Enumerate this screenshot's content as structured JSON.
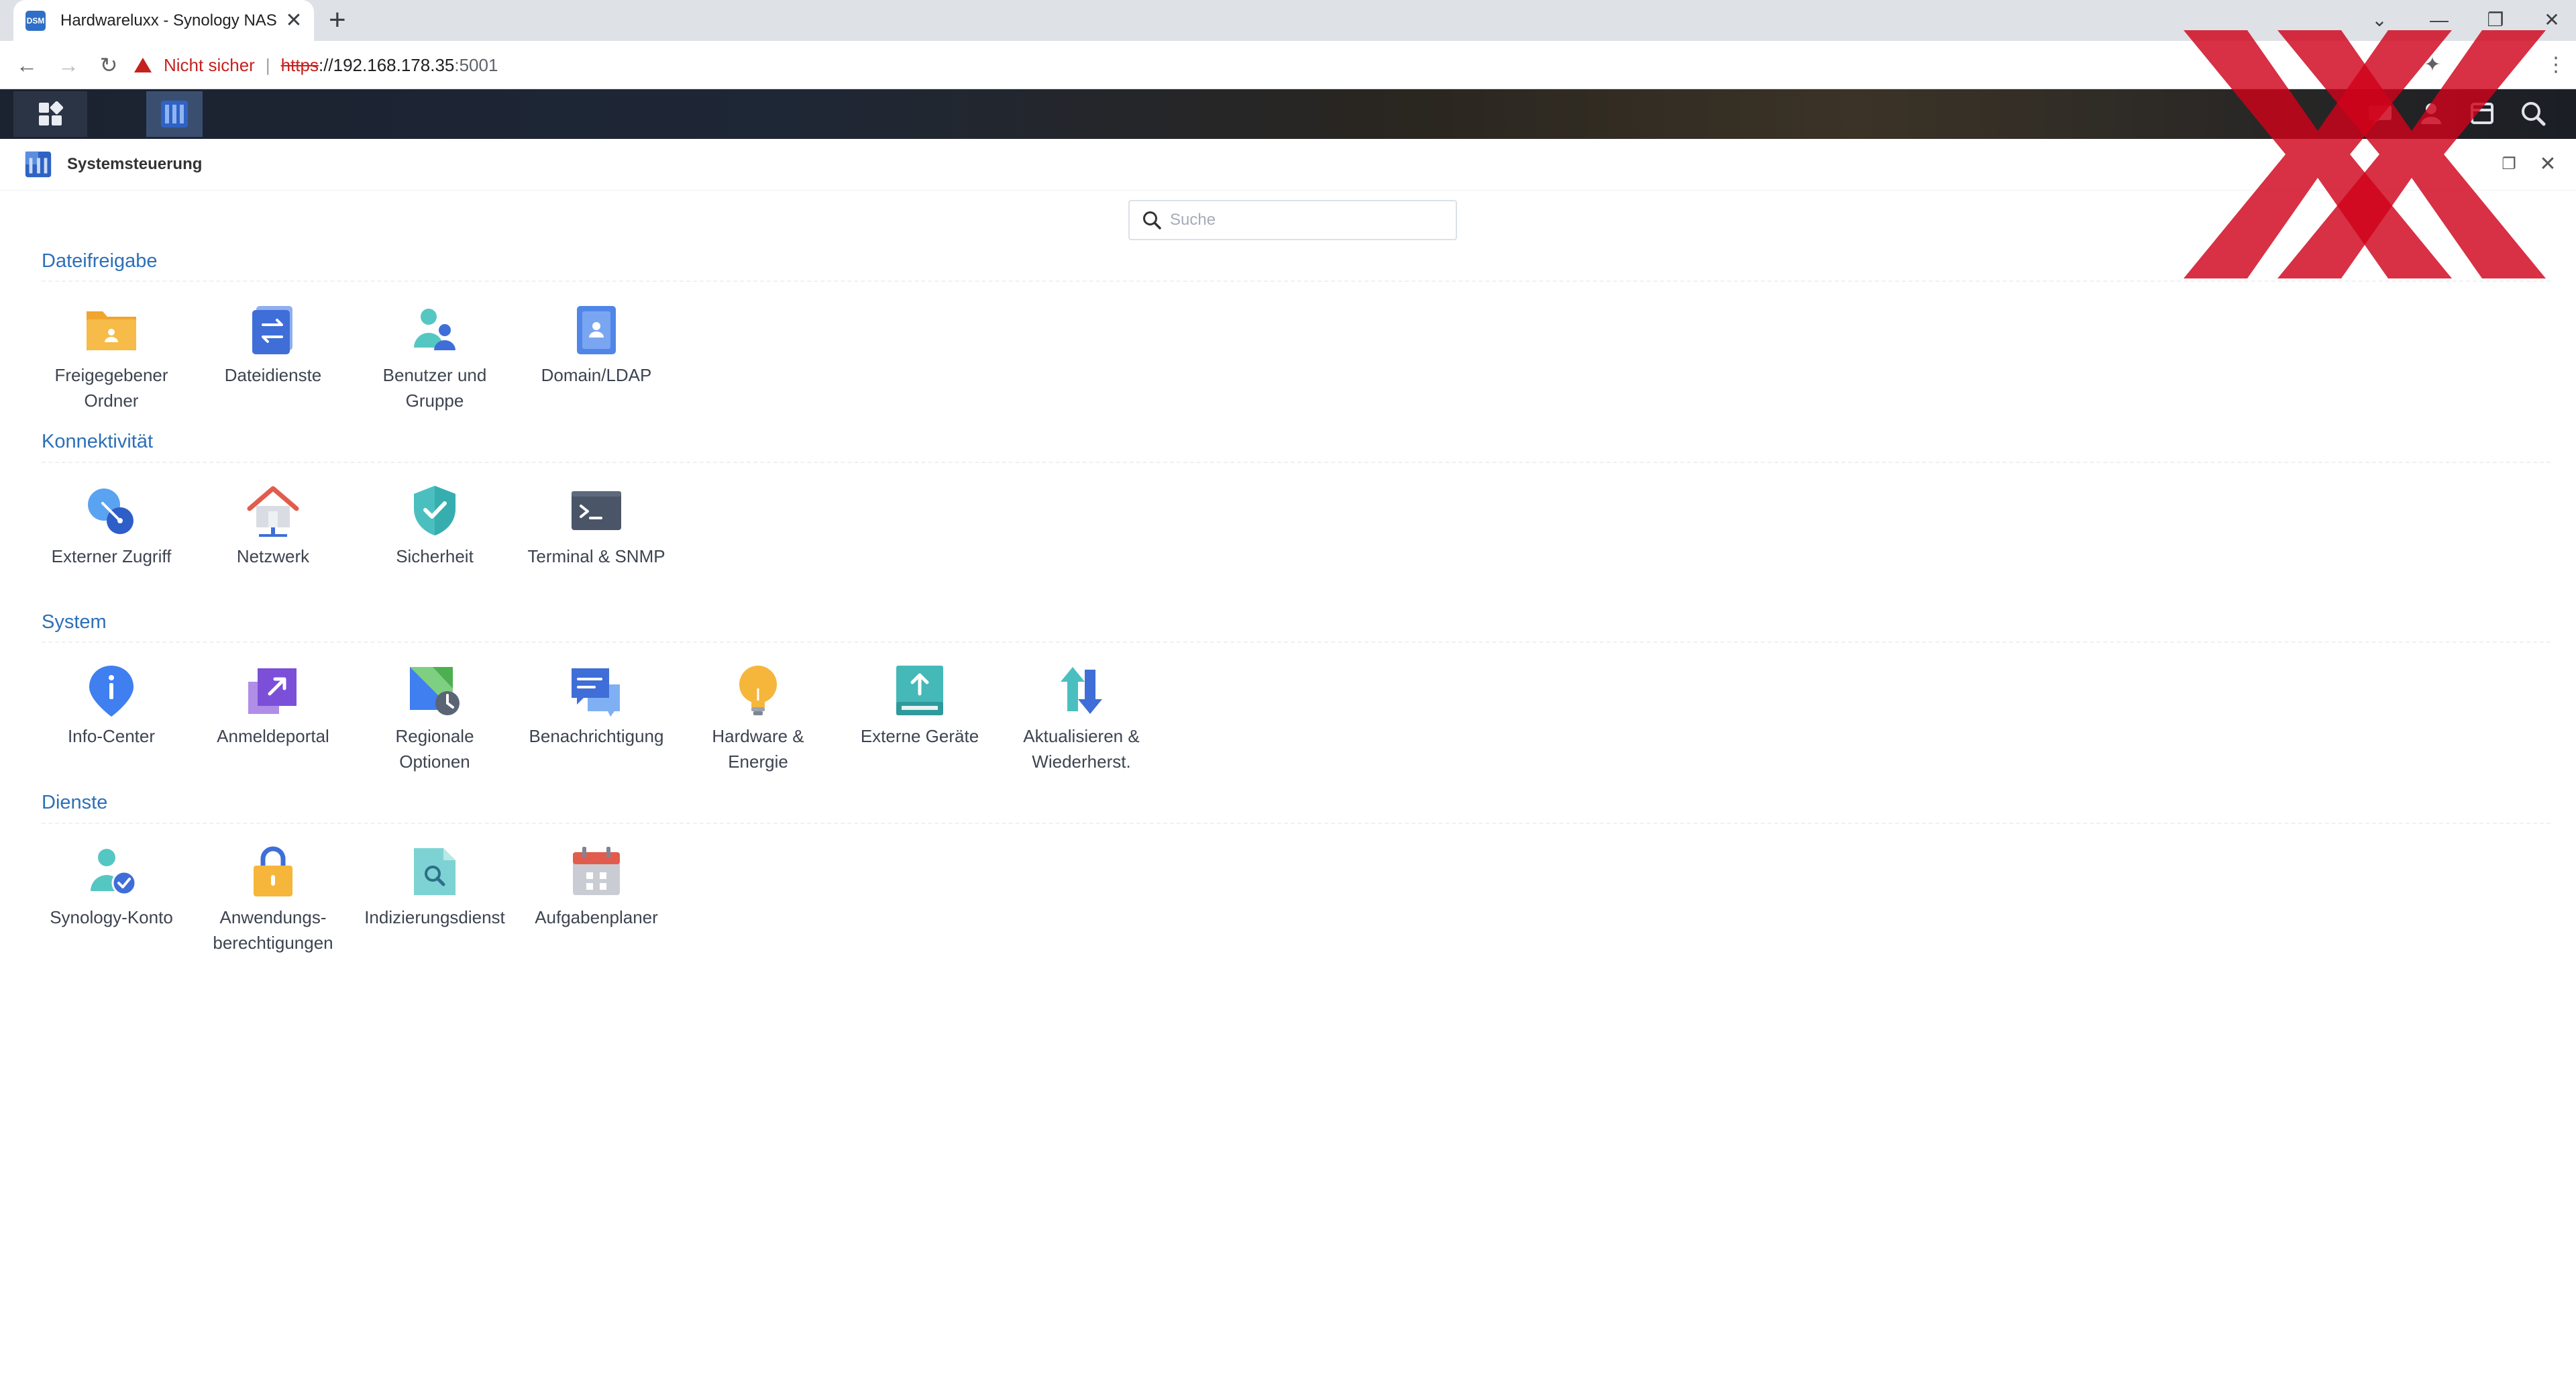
{
  "browser": {
    "tab_title": "Hardwareluxx - Synology NAS",
    "tab_favicon_text": "DSM",
    "security_warning": "Nicht sicher",
    "url_scheme": "https",
    "url_host": "://192.168.178.35",
    "url_port": ":5001"
  },
  "window": {
    "title": "Systemsteuerung"
  },
  "search": {
    "placeholder": "Suche"
  },
  "sections": {
    "dateifreigabe": {
      "title": "Dateifreigabe",
      "items": [
        {
          "label": "Freigegebener\nOrdner"
        },
        {
          "label": "Dateidienste"
        },
        {
          "label": "Benutzer und\nGruppe"
        },
        {
          "label": "Domain/LDAP"
        }
      ]
    },
    "konnektivitaet": {
      "title": "Konnektivität",
      "items": [
        {
          "label": "Externer Zugriff"
        },
        {
          "label": "Netzwerk"
        },
        {
          "label": "Sicherheit"
        },
        {
          "label": "Terminal & SNMP"
        }
      ]
    },
    "system": {
      "title": "System",
      "items": [
        {
          "label": "Info-Center"
        },
        {
          "label": "Anmeldeportal"
        },
        {
          "label": "Regionale\nOptionen"
        },
        {
          "label": "Benachrichtigung"
        },
        {
          "label": "Hardware &\nEnergie"
        },
        {
          "label": "Externe Geräte"
        },
        {
          "label": "Aktualisieren &\nWiederherst."
        }
      ]
    },
    "dienste": {
      "title": "Dienste",
      "items": [
        {
          "label": "Synology-Konto"
        },
        {
          "label": "Anwendungs-\nberechtigungen"
        },
        {
          "label": "Indizierungsdienst"
        },
        {
          "label": "Aufgabenplaner"
        }
      ]
    }
  },
  "colors": {
    "section_title": "#2d6fb8",
    "watermark": "#d0021b"
  }
}
